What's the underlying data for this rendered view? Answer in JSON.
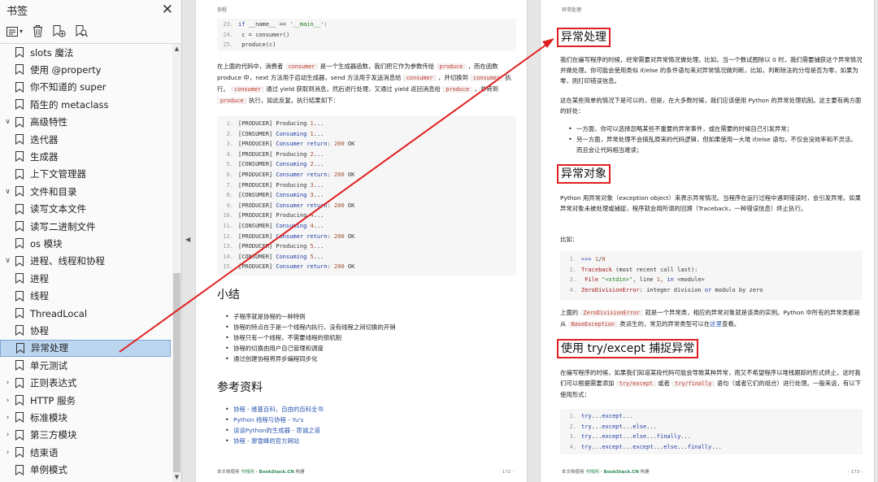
{
  "sidebar": {
    "title": "书签",
    "close_glyph": "✕",
    "toolbar": {
      "expand_glyph": "▾"
    },
    "items": [
      {
        "label": "slots 魔法",
        "expandable": false,
        "indent": 1
      },
      {
        "label": "使用 @property",
        "expandable": false,
        "indent": 1
      },
      {
        "label": "你不知道的 super",
        "expandable": false,
        "indent": 1
      },
      {
        "label": "陌生的 metaclass",
        "expandable": false,
        "indent": 1
      },
      {
        "label": "高级特性",
        "expandable": true,
        "expanded": true,
        "indent": 0
      },
      {
        "label": "迭代器",
        "expandable": false,
        "indent": 1
      },
      {
        "label": "生成器",
        "expandable": false,
        "indent": 1
      },
      {
        "label": "上下文管理器",
        "expandable": false,
        "indent": 1
      },
      {
        "label": "文件和目录",
        "expandable": true,
        "expanded": true,
        "indent": 0
      },
      {
        "label": "读写文本文件",
        "expandable": false,
        "indent": 1
      },
      {
        "label": "读写二进制文件",
        "expandable": false,
        "indent": 1
      },
      {
        "label": "os 模块",
        "expandable": false,
        "indent": 1
      },
      {
        "label": "进程、线程和协程",
        "expandable": true,
        "expanded": true,
        "indent": 0
      },
      {
        "label": "进程",
        "expandable": false,
        "indent": 1
      },
      {
        "label": "线程",
        "expandable": false,
        "indent": 1
      },
      {
        "label": "ThreadLocal",
        "expandable": false,
        "indent": 1
      },
      {
        "label": "协程",
        "expandable": false,
        "indent": 1
      },
      {
        "label": "异常处理",
        "expandable": false,
        "indent": 0,
        "selected": true
      },
      {
        "label": "单元测试",
        "expandable": false,
        "indent": 0
      },
      {
        "label": "正则表达式",
        "expandable": true,
        "expanded": false,
        "indent": 0
      },
      {
        "label": "HTTP 服务",
        "expandable": true,
        "expanded": false,
        "indent": 0
      },
      {
        "label": "标准模块",
        "expandable": true,
        "expanded": false,
        "indent": 0
      },
      {
        "label": "第三方模块",
        "expandable": true,
        "expanded": false,
        "indent": 0
      },
      {
        "label": "结束语",
        "expandable": true,
        "expanded": false,
        "indent": 0
      },
      {
        "label": "单例模式",
        "expandable": false,
        "indent": 0
      }
    ]
  },
  "left_page": {
    "running_head": "协程",
    "code1": [
      {
        "n": "23.",
        "html": "<span class='kw'>if</span> __name__ == <span class='str'>'__main__'</span>:"
      },
      {
        "n": "24.",
        "html": "    c = consumer()"
      },
      {
        "n": "25.",
        "html": "    produce(c)"
      }
    ],
    "para": "在上面的代码中，消费者 <span class='ic'>consumer</span> 是一个生成器函数，我们把它作为参数传给 <span class='ic'>produce</span> ，而在函数 produce 中，next 方法用于启动生成器，send 方法用于发送消息给 <span class='ic'>consumer</span> ，并切换到 <span class='ic'>consumer</span> 执行。 <span class='ic'>consumer</span> 通过 yield 获取到消息，然后进行处理，又通过 yield 返回消息给 <span class='ic'>produce</span> ，并转到 <span class='ic'>produce</span> 执行，如此反复。执行结果如下：",
    "output": [
      {
        "n": "1.",
        "html": "[PRODUCER] Producing <span class='num'>1</span>..."
      },
      {
        "n": "2.",
        "html": "[CONSUMER] <span class='kw'>Consuming</span> <span class='num'>1</span>..."
      },
      {
        "n": "3.",
        "html": "[PRODUCER] <span class='kw'>Consumer return</span>: <span class='num'>200</span> OK"
      },
      {
        "n": "4.",
        "html": "[PRODUCER] Producing <span class='num'>2</span>..."
      },
      {
        "n": "5.",
        "html": "[CONSUMER] <span class='kw'>Consuming</span> <span class='num'>2</span>..."
      },
      {
        "n": "6.",
        "html": "[PRODUCER] <span class='kw'>Consumer return</span>: <span class='num'>200</span> OK"
      },
      {
        "n": "7.",
        "html": "[PRODUCER] Producing <span class='num'>3</span>..."
      },
      {
        "n": "8.",
        "html": "[CONSUMER] <span class='kw'>Consuming</span> <span class='num'>3</span>..."
      },
      {
        "n": "9.",
        "html": "[PRODUCER] <span class='kw'>Consumer return</span>: <span class='num'>200</span> OK"
      },
      {
        "n": "10.",
        "html": "[PRODUCER] Producing <span class='num'>4</span>..."
      },
      {
        "n": "11.",
        "html": "[CONSUMER] <span class='kw'>Consuming</span> <span class='num'>4</span>..."
      },
      {
        "n": "12.",
        "html": "[PRODUCER] <span class='kw'>Consumer return</span>: <span class='num'>200</span> OK"
      },
      {
        "n": "13.",
        "html": "[PRODUCER] Producing <span class='num'>5</span>..."
      },
      {
        "n": "14.",
        "html": "[CONSUMER] <span class='kw'>Consuming</span> <span class='num'>5</span>..."
      },
      {
        "n": "15.",
        "html": "[PRODUCER] <span class='kw'>Consumer return</span>: <span class='num'>200</span> OK"
      }
    ],
    "summary_title": "小结",
    "summary_items": [
      "子程序就是协程的一种特例",
      "协程的特点在于是一个线程内执行，没有线程之间切换的开销",
      "协程只有一个线程，不需要线程的锁机制",
      "协程的切换由用户自己管理和调度",
      "通过创建协程将异步编程同步化"
    ],
    "refs_title": "参考资料",
    "refs": [
      "协程 - 维基百科，自由的百科全书",
      "Python 线程与协程 - Yu's",
      "谈谈Python的生成器 - 思诚之道",
      "协程 - 廖雪峰的官方网站"
    ],
    "footer_prefix": "本文档使用 ",
    "footer_site": "书栈网",
    "footer_site2": "· BookStack.CN",
    "footer_suffix": " 构建",
    "page_num": "- 172 -"
  },
  "right_page": {
    "running_head": "异常处理",
    "h1": "异常处理",
    "p1": "我们在编写程序的时候，经常需要对异常情况做处理。比如，当一个数试图除以 0 时，我们需要捕获这个异常情况并做处理。你可能会使用类似 if/else 的条件语句来对异常情况做判断，比如，判断除法的分母是否为零，如果为零，则打印错误信息。",
    "p2": "这在某些简单的情况下是可以的，但是，在大多数时候，我们应该使用 Python 的异常处理机制。这主要有两方面的好处：",
    "benefits": [
      "一方面，你可以选择忽略某些不重要的异常事件，或在需要的时候自己引发异常；",
      "另一方面，异常处理不会搞乱原来的代码逻辑，但如果使用一大堆 if/else 语句，不仅会没效率和不灵活，而且会让代码相当难读；"
    ],
    "h2": "异常对象",
    "p3": "Python 用异常对象（exception object）来表示异常情况。当程序在运行过程中遇到错误时，会引发异常。如果异常对象未被处理或捕捉，程序就会用所谓的回溯（Traceback，一种错误信息）终止执行。",
    "p4": "比如：",
    "code": [
      {
        "n": "1.",
        "html": "<span class='kw'>&gt;&gt;&gt;</span> <span class='num'>1</span>/<span class='num'>0</span>"
      },
      {
        "n": "2.",
        "html": "<span class='err'>Traceback</span> (most recent call last):"
      },
      {
        "n": "3.",
        "html": "  <span class='err'>File</span> <span class='str'>\"&lt;stdin&gt;\"</span>, line <span class='num'>1</span>, <span class='kw'>in</span> &lt;module&gt;"
      },
      {
        "n": "4.",
        "html": "<span class='err'>ZeroDivisionError</span>: integer division <span class='kw'>or</span> modulo by zero"
      }
    ],
    "p5": "上面的 <span class='ic'>ZeroDivisionError</span> 就是一个异常类，相应的异常对象就是该类的实例。Python 中所有的异常类都是从 <span class='ic'>BaseException</span> 类派生的，常见的异常类型可以在<span style='color:#2a56b0'>这里</span>查看。",
    "h3": "使用 try/except 捕捉异常",
    "p6": "在编写程序的时候，如果我们知道某段代码可能会导致某种异常，而又不希望程序以堆栈跟踪的形式终止，这时我们可以根据需要添加 <span class='ic'>try/except</span> 或者 <span class='ic'>try/finally</span> 语句（或者它们的组合）进行处理。一般来说，有以下使用形式：",
    "code2": [
      {
        "n": "1.",
        "html": "<span class='kw'>try</span>...<span class='kw'>except</span>..."
      },
      {
        "n": "2.",
        "html": "<span class='kw'>try</span>...<span class='kw'>except</span>...<span class='kw'>else</span>..."
      },
      {
        "n": "3.",
        "html": "<span class='kw'>try</span>...<span class='kw'>except</span>...<span class='kw'>else</span>...<span class='kw'>finally</span>..."
      },
      {
        "n": "4.",
        "html": "<span class='kw'>try</span>...<span class='kw'>except</span>...<span class='kw'>except</span>...<span class='kw'>else</span>...<span class='kw'>finally</span>..."
      }
    ],
    "footer_prefix": "本文档使用 ",
    "footer_site": "书栈网",
    "footer_site2": "· BookStack.CN",
    "footer_suffix": " 构建",
    "page_num": "- 173 -"
  },
  "colors": {
    "highlight": "#e02020",
    "selection": "#bcd6f0",
    "link": "#2a56b0"
  }
}
